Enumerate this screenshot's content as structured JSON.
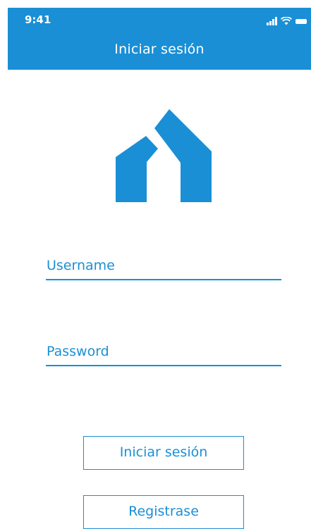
{
  "status_bar": {
    "time": "9:41",
    "icons": [
      "signal-icon",
      "wifi-icon",
      "battery-icon"
    ]
  },
  "header": {
    "title": "Iniciar sesión"
  },
  "logo": {
    "icon": "house-logo-icon"
  },
  "form": {
    "username_label": "Username",
    "password_label": "Password"
  },
  "actions": {
    "login_label": "Iniciar sesión",
    "register_label": "Registrase"
  },
  "colors": {
    "primary": "#1a8fd6",
    "background": "#ffffff"
  }
}
